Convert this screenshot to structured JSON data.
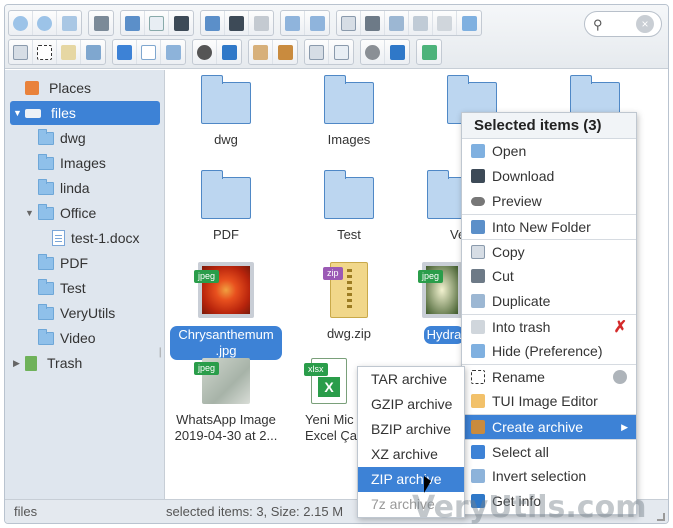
{
  "search": {
    "placeholder": ""
  },
  "sidebar": {
    "items": [
      {
        "label": "Places"
      },
      {
        "label": "files"
      },
      {
        "label": "dwg"
      },
      {
        "label": "Images"
      },
      {
        "label": "linda"
      },
      {
        "label": "Office"
      },
      {
        "label": "test-1.docx"
      },
      {
        "label": "PDF"
      },
      {
        "label": "Test"
      },
      {
        "label": "VeryUtils"
      },
      {
        "label": "Video"
      },
      {
        "label": "Trash"
      }
    ]
  },
  "files": [
    {
      "name": "dwg"
    },
    {
      "name": "Images"
    },
    {
      "name": "PDF"
    },
    {
      "name": "Test"
    },
    {
      "name": "Ve"
    },
    {
      "name": "Chrysanthemum\n.jpg",
      "badge": "jpeg"
    },
    {
      "name": "dwg.zip",
      "badge": "zip"
    },
    {
      "name": "Hydra",
      "badge": "jpeg"
    },
    {
      "name": "WhatsApp Image\n2019-04-30 at 2...",
      "badge": "jpeg"
    },
    {
      "name": "Yeni Mic\nExcel Ça",
      "badge": "xlsx"
    }
  ],
  "context_menu": {
    "title": "Selected items (3)",
    "items": [
      {
        "label": "Open",
        "icon": "open-icon"
      },
      {
        "label": "Download",
        "icon": "download-icon"
      },
      {
        "label": "Preview",
        "icon": "eye-icon"
      },
      {
        "label": "Into New Folder",
        "icon": "new-folder-icon"
      },
      {
        "label": "Copy",
        "icon": "copy-icon"
      },
      {
        "label": "Cut",
        "icon": "scissors-icon"
      },
      {
        "label": "Duplicate",
        "icon": "duplicate-icon"
      },
      {
        "label": "Into trash",
        "icon": "trash-icon"
      },
      {
        "label": "Hide (Preference)",
        "icon": "hide-icon"
      },
      {
        "label": "Rename",
        "icon": "rename-icon"
      },
      {
        "label": "TUI Image Editor",
        "icon": "image-editor-icon"
      },
      {
        "label": "Create archive",
        "icon": "archive-icon"
      },
      {
        "label": "Select all",
        "icon": "select-all-icon"
      },
      {
        "label": "Invert selection",
        "icon": "invert-selection-icon"
      },
      {
        "label": "Get info",
        "icon": "info-icon"
      }
    ]
  },
  "archive_submenu": {
    "items": [
      {
        "label": "TAR archive"
      },
      {
        "label": "GZIP archive"
      },
      {
        "label": "BZIP archive"
      },
      {
        "label": "XZ archive"
      },
      {
        "label": "ZIP archive"
      },
      {
        "label": "7z archive"
      }
    ]
  },
  "status": {
    "left": "files",
    "right": "selected items: 3, Size: 2.15 M"
  },
  "watermark": "VeryUtils.com",
  "colors": {
    "accent": "#3d82d6",
    "folder": "#bcd6f0",
    "sidebar_bg": "#dfe6ee"
  }
}
